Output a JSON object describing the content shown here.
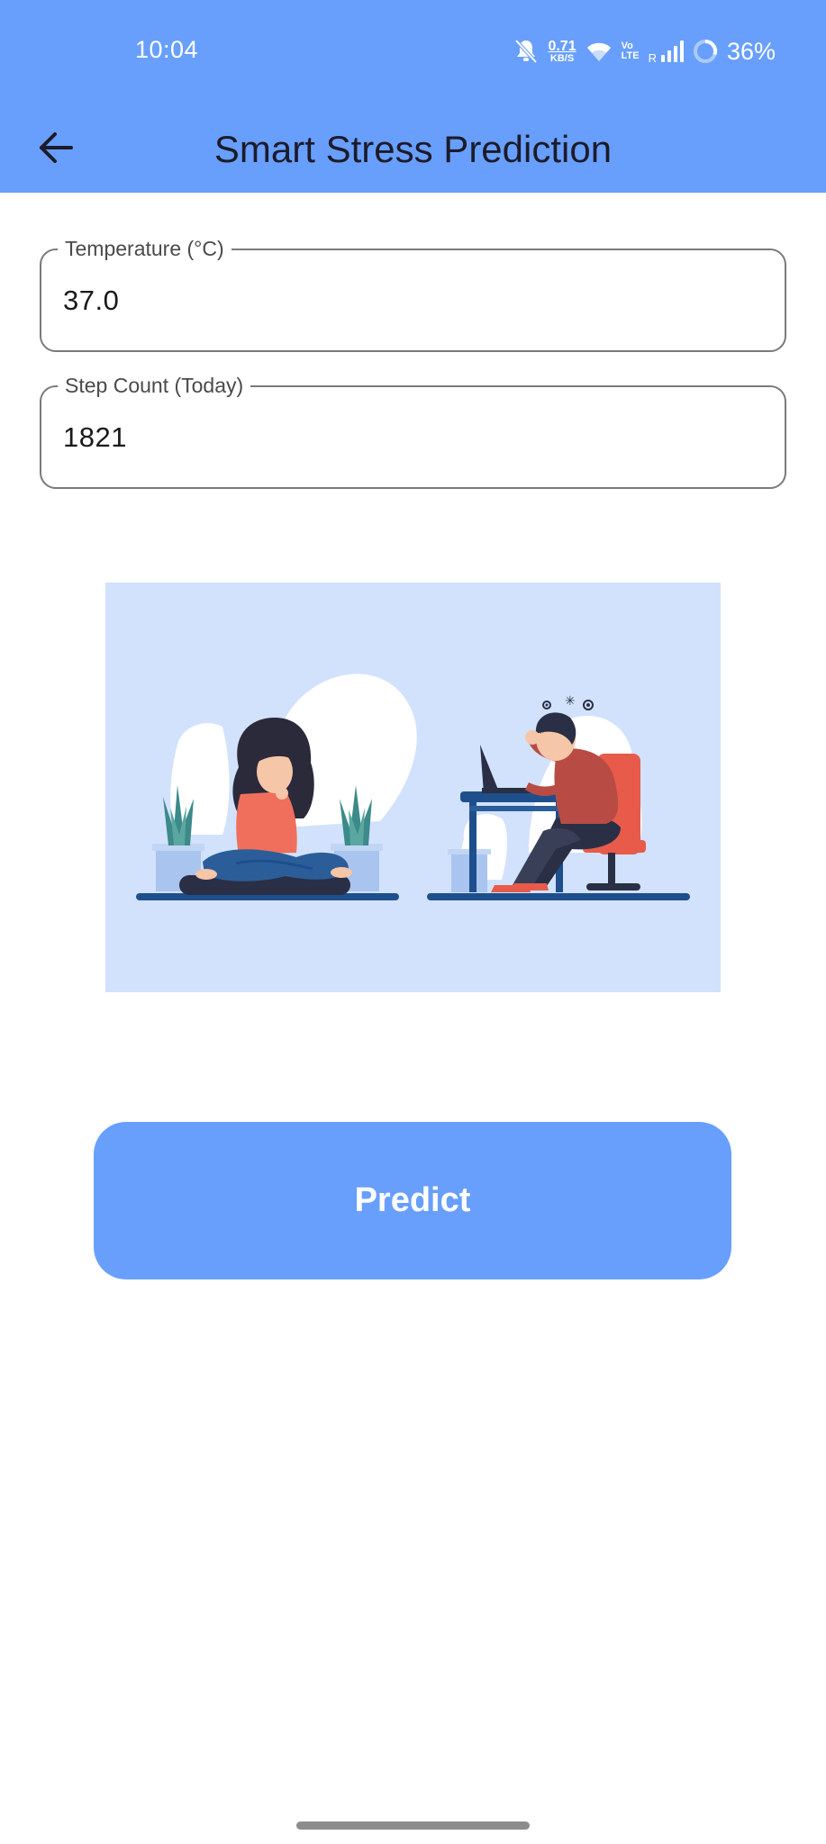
{
  "status_bar": {
    "time": "10:04",
    "net_speed_value": "0.71",
    "net_speed_unit": "KB/S",
    "volte_top": "Vo",
    "volte_bottom": "LTE",
    "roaming": "R",
    "battery_percent": "36%",
    "icons": [
      "bell-muted-icon",
      "wifi-icon",
      "signal-bars-icon",
      "battery-ring-icon"
    ]
  },
  "app_bar": {
    "title": "Smart Stress Prediction",
    "back_icon": "arrow-left-icon"
  },
  "form": {
    "temperature": {
      "label": "Temperature (°C)",
      "value": "37.0"
    },
    "steps": {
      "label": "Step Count (Today)",
      "value": "1821"
    }
  },
  "illustration": {
    "description_icon": "relaxed-vs-stressed-illustration"
  },
  "predict": {
    "label": "Predict"
  },
  "colors": {
    "primary": "#689ffd",
    "illustration_bg": "#d2e2fc",
    "title_text": "#1c1b2a"
  }
}
